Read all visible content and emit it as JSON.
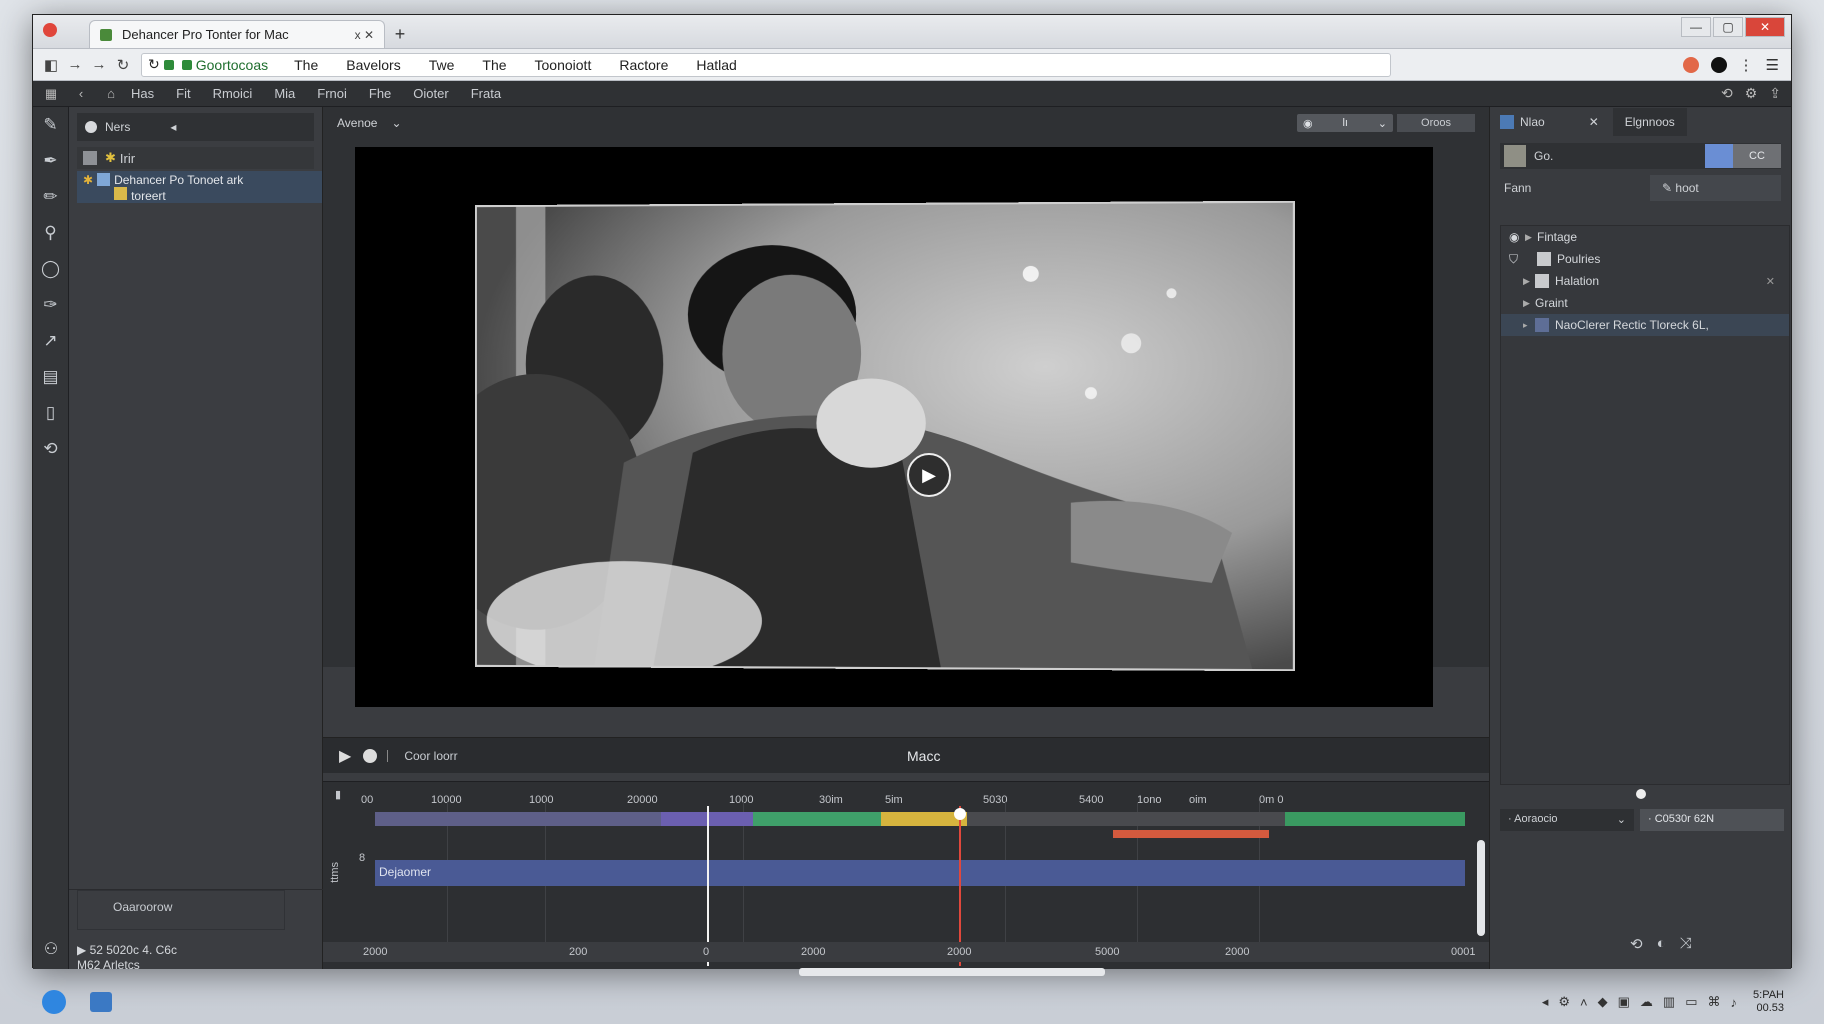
{
  "browser": {
    "tab_title": "Dehancer Pro Tonter for Mac",
    "tab_close": "x ✕",
    "new_tab": "+",
    "url": "Goortocoas",
    "menu": [
      "The",
      "Bavelors",
      "Twe",
      "The",
      "Toonoiott",
      "Ractore",
      "Hatlad"
    ]
  },
  "app_menu": {
    "items": [
      "Has",
      "Fit",
      "Rmoici",
      "Mia",
      "Frnoi",
      "Fhe",
      "Oioter",
      "Frata"
    ]
  },
  "project": {
    "header": "Ners",
    "row1": "Irir",
    "selected_line1": "Dehancer Po Tonoet ark",
    "selected_line2": "toreert",
    "footer": "Oaaroorow",
    "info_line1": "▶ 52 5020c  4. C6c",
    "info_line2": "M62 Arletcs"
  },
  "viewer": {
    "tab": "Avenoe",
    "zoom": "Oroos",
    "seg_label": "lı",
    "transport_label": "Coor loorr",
    "center_label": "Macc"
  },
  "timeline": {
    "ruler": [
      "00",
      "10000",
      "1000",
      "20000",
      "1000",
      "30im",
      "5im",
      "5030",
      "5400",
      "1ono",
      "oim",
      "0m 0"
    ],
    "clip_label": "Dejaomer",
    "track_label": "ttms",
    "track_num": "8",
    "bottom_ruler": [
      "2000",
      "200",
      "0",
      "2000",
      "2000",
      "5000",
      "2000",
      "0001"
    ],
    "segments": [
      {
        "color": "#5e5f88"
      },
      {
        "color": "#6b5fb0"
      },
      {
        "color": "#3fa06a"
      },
      {
        "color": "#d6b43e"
      },
      {
        "color": "#494a4e"
      },
      {
        "color": "#3a9a61"
      }
    ]
  },
  "inspector": {
    "tab1": "Nlao",
    "tab2": "Elgnnoos",
    "search": "Go.",
    "search_btn": "CC",
    "col1": "Fann",
    "col2": "hoot",
    "items": [
      {
        "label": "Fintage",
        "checkbox": false
      },
      {
        "label": "Poulries",
        "checkbox": true
      },
      {
        "label": "Halation",
        "checkbox": true
      },
      {
        "label": "Graint",
        "checkbox": false
      },
      {
        "label": "NaoClerer Rectic Tloreck 6L,",
        "checkbox": true
      }
    ],
    "dropdown": "Aoraocio",
    "value": "C0530r 62N"
  },
  "taskbar": {
    "clock_time": "5:PAH",
    "clock_date": "00.53"
  }
}
